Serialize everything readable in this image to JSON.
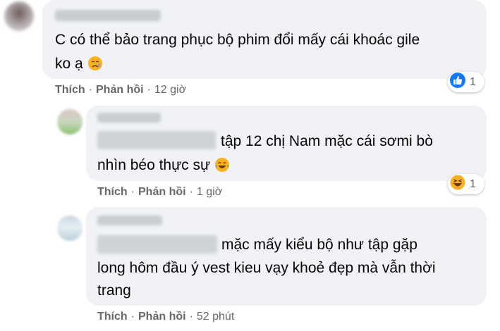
{
  "comments": [
    {
      "text_line1": "C có thể bảo trang phục bộ phim đổi mấy cái khoác gile",
      "text_line2": "ko ạ",
      "emoji": "crying-face",
      "action_like": "Thích",
      "action_reply": "Phản hồi",
      "time": "12 giờ",
      "reaction": {
        "type": "like",
        "count": "1",
        "color": "#1877f2"
      }
    },
    {
      "text_line1": "tập 12 chị Nam mặc cái sơmi bò",
      "text_line2": "nhìn béo thực sự",
      "emoji": "laughing-tears",
      "action_like": "Thích",
      "action_reply": "Phản hồi",
      "time": "1 giờ",
      "reaction": {
        "type": "haha",
        "count": "1",
        "color": "#f7b125"
      }
    },
    {
      "text_line1": "mặc mấy kiểu bộ như tập gặp",
      "text_line2": "long hôm đầu ý vest kieu vạy khoẻ đẹp mà vẫn thời",
      "text_line3": "trang",
      "action_like": "Thích",
      "action_reply": "Phản hồi",
      "time": "52 phút"
    }
  ],
  "separator": "·",
  "colors": {
    "bubble": "#f0f2f5",
    "meta": "#65676b",
    "text": "#050505"
  }
}
